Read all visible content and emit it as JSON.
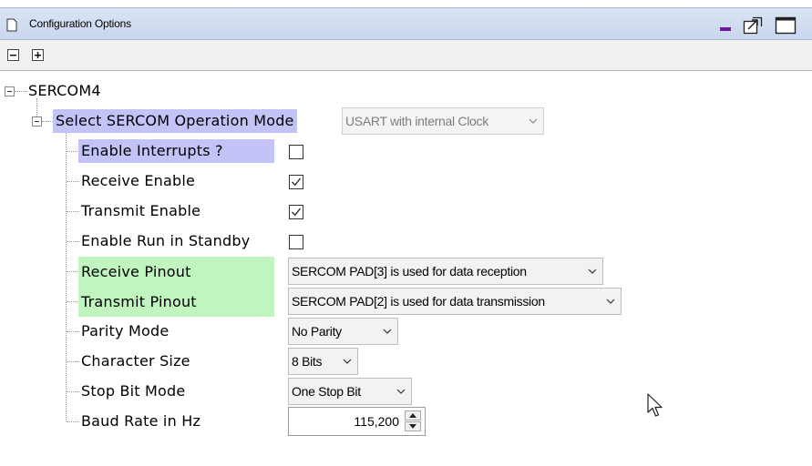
{
  "window": {
    "title": "Configuration Options",
    "icons": {
      "doc": "document-icon",
      "minimize": "minimize-icon",
      "restore": "restore-icon",
      "maximize": "maximize-icon"
    }
  },
  "toolbar": {
    "collapse_all": "collapse-all-icon",
    "expand_all": "expand-all-icon"
  },
  "tree": {
    "root": "SERCOM4",
    "operation_mode": {
      "label": "Select SERCOM Operation Mode",
      "value": "USART with internal Clock"
    },
    "interrupts": {
      "label": "Enable Interrupts ?",
      "checked": false
    },
    "receive_enable": {
      "label": "Receive Enable",
      "checked": true
    },
    "transmit_enable": {
      "label": "Transmit Enable",
      "checked": true
    },
    "run_standby": {
      "label": "Enable Run in Standby",
      "checked": false
    },
    "receive_pinout": {
      "label": "Receive Pinout",
      "value": "SERCOM PAD[3] is used for data reception"
    },
    "transmit_pinout": {
      "label": "Transmit Pinout",
      "value": "SERCOM PAD[2] is used for data transmission"
    },
    "parity": {
      "label": "Parity Mode",
      "value": "No Parity"
    },
    "char_size": {
      "label": "Character Size",
      "value": "8 Bits"
    },
    "stop_bit": {
      "label": "Stop Bit Mode",
      "value": "One Stop Bit"
    },
    "baud": {
      "label": "Baud Rate in Hz",
      "value": "115,200"
    }
  },
  "colors": {
    "titlebar": "#c9d6ee",
    "highlight_blue": "#c3c3f7",
    "highlight_green": "#c0f5c0"
  }
}
